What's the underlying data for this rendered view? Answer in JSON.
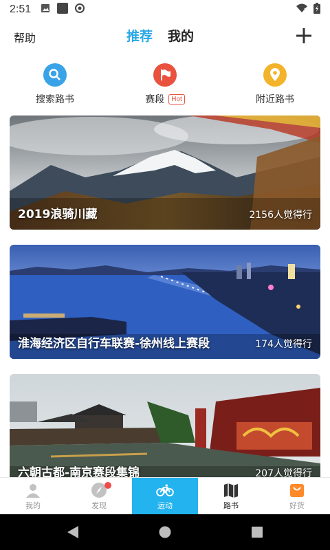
{
  "status": {
    "time": "2:51"
  },
  "topnav": {
    "help": "帮助",
    "tabs": [
      "推荐",
      "我的"
    ]
  },
  "quick": [
    {
      "label": "搜索路书",
      "icon": "search-icon",
      "color": "#3aa3e8"
    },
    {
      "label": "赛段",
      "badge": "Hot",
      "icon": "flag-icon",
      "color": "#e9523f"
    },
    {
      "label": "附近路书",
      "icon": "location-pin-icon",
      "color": "#f3b32a"
    }
  ],
  "cards": [
    {
      "title": "2019浪骑川藏",
      "count": "2156人觉得行"
    },
    {
      "title": "淮海经济区自行车联赛-徐州线上赛段",
      "count": "174人觉得行"
    },
    {
      "title": "六朝古都-南京赛段集锦",
      "count": "207人觉得行"
    }
  ],
  "bottombar": [
    {
      "label": "我的",
      "icon": "person-icon"
    },
    {
      "label": "发现",
      "icon": "compass-icon"
    },
    {
      "label": "运动",
      "icon": "bicycle-icon"
    },
    {
      "label": "路书",
      "icon": "map-icon"
    },
    {
      "label": "好货",
      "icon": "shopping-bag-icon"
    }
  ],
  "colors": {
    "accent": "#29a8e8",
    "active_tab_bg": "#23b3ee",
    "badge_red": "#f04b4b"
  }
}
